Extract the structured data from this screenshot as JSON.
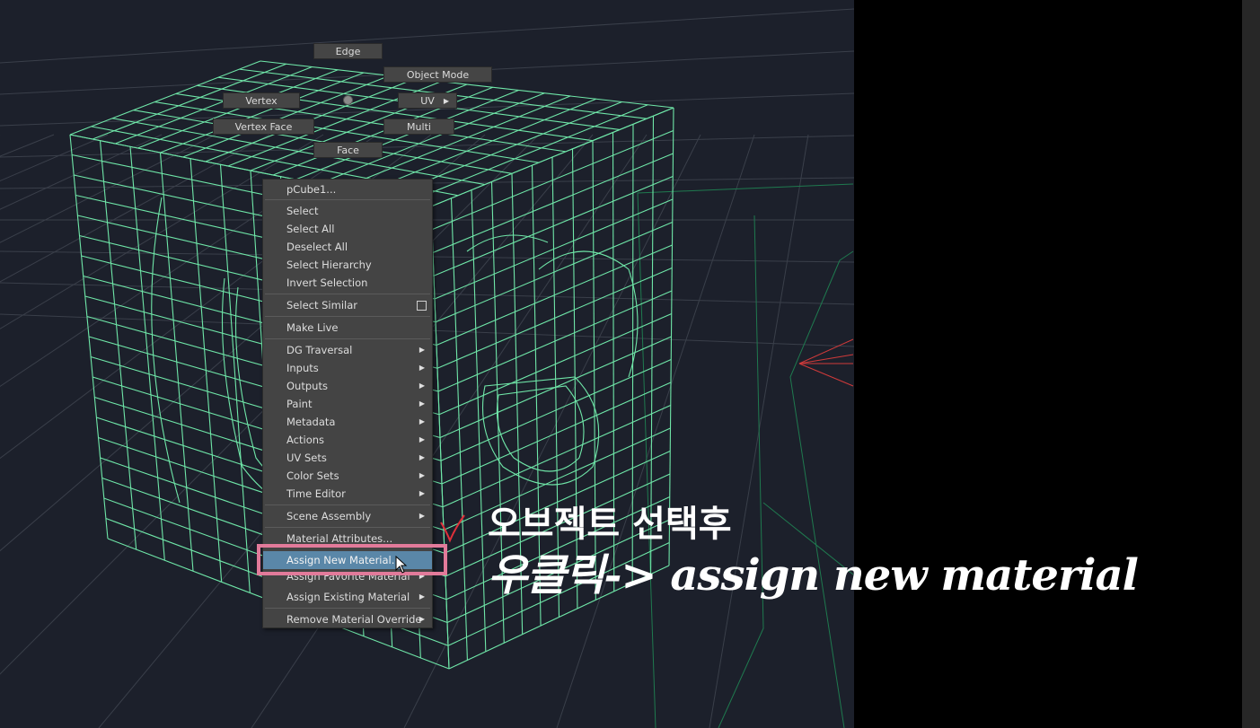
{
  "marking_menu": {
    "edge": "Edge",
    "object_mode": "Object Mode",
    "vertex": "Vertex",
    "uv": "UV",
    "vertex_face": "Vertex Face",
    "multi": "Multi",
    "face": "Face"
  },
  "context_menu": {
    "title": "pCube1...",
    "items": [
      {
        "label": "Select"
      },
      {
        "label": "Select All"
      },
      {
        "label": "Deselect All"
      },
      {
        "label": "Select Hierarchy"
      },
      {
        "label": "Invert Selection"
      },
      {
        "label": "Select Similar"
      },
      {
        "label": "Make Live"
      },
      {
        "label": "DG Traversal"
      },
      {
        "label": "Inputs"
      },
      {
        "label": "Outputs"
      },
      {
        "label": "Paint"
      },
      {
        "label": "Metadata"
      },
      {
        "label": "Actions"
      },
      {
        "label": "UV Sets"
      },
      {
        "label": "Color Sets"
      },
      {
        "label": "Time Editor"
      },
      {
        "label": "Scene Assembly"
      },
      {
        "label": "Material Attributes..."
      },
      {
        "label": "Assign New Material..."
      },
      {
        "label": "Assign Favorite Material"
      },
      {
        "label": "Assign Existing Material"
      },
      {
        "label": "Remove Material Override"
      }
    ]
  },
  "annotation": {
    "line1": "오브젝트 선택후",
    "line2": "우클릭-> assign new material"
  },
  "colors": {
    "viewport_bg": "#1c202b",
    "wireframe": "#6fe6a8",
    "menu_bg": "#444444",
    "menu_highlight": "#5a87a8",
    "highlight_box": "#e27a9a",
    "annotation_text": "#ffffff"
  },
  "icons": {
    "submenu_arrow": "triangle-right-icon",
    "option_box": "option-box-icon",
    "cursor": "mouse-cursor-icon",
    "check_mark": "check-mark-icon"
  }
}
